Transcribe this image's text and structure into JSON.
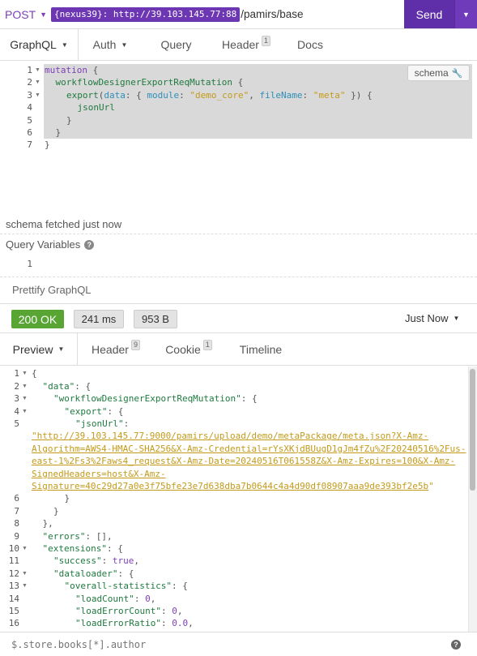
{
  "request": {
    "method": "POST",
    "env_tag": "{nexus39}: http://39.103.145.77:88",
    "url_path": "/pamirs/base",
    "send_label": "Send"
  },
  "request_tabs": {
    "graphql": "GraphQL",
    "auth": "Auth",
    "query": "Query",
    "header": "Header",
    "header_count": "1",
    "docs": "Docs"
  },
  "query_editor": {
    "schema_button": "schema",
    "line_numbers": [
      "1",
      "2",
      "3",
      "4",
      "5",
      "6",
      "7"
    ],
    "l1_kw": "mutation",
    "l1_brace": " {",
    "l2_field": "workflowDesignerExportReqMutation",
    "l2_brace": " {",
    "l3_field": "export",
    "l3_open": "(",
    "l3_arg1": "data",
    "l3_colon1": ": { ",
    "l3_arg2": "module",
    "l3_colon2": ": ",
    "l3_str1": "\"demo_core\"",
    "l3_comma": ", ",
    "l3_arg3": "fileName",
    "l3_colon3": ": ",
    "l3_str2": "\"meta\"",
    "l3_close": " }) {",
    "l4_field": "jsonUrl",
    "l5": "}",
    "l6": "}",
    "l7": "}"
  },
  "schema_status": "schema fetched just now",
  "query_variables": {
    "title": "Query Variables",
    "line_number": "1"
  },
  "prettify_label": "Prettify GraphQL",
  "response_status": {
    "status": "200 OK",
    "time": "241 ms",
    "size": "953 B",
    "history": "Just Now"
  },
  "response_tabs": {
    "preview": "Preview",
    "header": "Header",
    "header_count": "9",
    "cookie": "Cookie",
    "cookie_count": "1",
    "timeline": "Timeline"
  },
  "response_body": {
    "line_numbers": [
      "1",
      "2",
      "3",
      "4",
      "5",
      "6",
      "7",
      "8",
      "9",
      "10",
      "11",
      "12",
      "13",
      "14",
      "15",
      "16"
    ],
    "l1": "{",
    "l2_key": "\"data\"",
    "l2_rest": ": {",
    "l3_key": "\"workflowDesignerExportReqMutation\"",
    "l3_rest": ": {",
    "l4_key": "\"export\"",
    "l4_rest": ": {",
    "l5_key": "\"jsonUrl\"",
    "l5_rest": ":",
    "url_lines": [
      "\"http://39.103.145.77:9000/pamirs/upload/demo/metaPackage/meta.json?X-Amz-",
      "Algorithm=AWS4-HMAC-SHA256&X-Amz-Credential=rYsXKjdBUugD1gJm4fZu%2F20240516%2Fus-",
      "east-1%2Fs3%2Faws4_request&X-Amz-Date=20240516T061558Z&X-Amz-Expires=100&X-Amz-",
      "SignedHeaders=host&X-Amz-",
      "Signature=40c29d27a0e3f75bfe23e7d638dba7b0644c4a4d90df08907aaa9de393bf2e5b"
    ],
    "url_end_quote": "\"",
    "l6": "}",
    "l7": "}",
    "l8": "},",
    "l9_key": "\"errors\"",
    "l9_rest": ": [],",
    "l10_key": "\"extensions\"",
    "l10_rest": ": {",
    "l11_key": "\"success\"",
    "l11_sep": ": ",
    "l11_val": "true",
    "l11_comma": ",",
    "l12_key": "\"dataloader\"",
    "l12_rest": ": {",
    "l13_key": "\"overall-statistics\"",
    "l13_rest": ": {",
    "l14_key": "\"loadCount\"",
    "l14_sep": ": ",
    "l14_val": "0",
    "l14_comma": ",",
    "l15_key": "\"loadErrorCount\"",
    "l15_sep": ": ",
    "l15_val": "0",
    "l15_comma": ",",
    "l16_key": "\"loadErrorRatio\"",
    "l16_sep": ": ",
    "l16_val": "0.0",
    "l16_comma": ","
  },
  "filter": {
    "placeholder": "$.store.books[*].author"
  },
  "colors": {
    "accent": "#6d37b4",
    "send": "#5f2fa9",
    "status_ok": "#58a534"
  }
}
